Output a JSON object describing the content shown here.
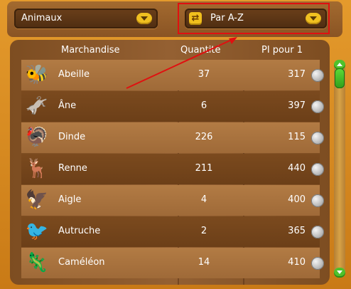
{
  "filters": {
    "category": "Animaux",
    "sort": "Par A-Z"
  },
  "table": {
    "columns": [
      "Marchandise",
      "Quantité",
      "PI pour 1"
    ],
    "rows": [
      {
        "name": "Abeille",
        "quantity": "37",
        "price": "317",
        "icon": "bee-icon"
      },
      {
        "name": "Âne",
        "quantity": "6",
        "price": "397",
        "icon": "donkey-icon"
      },
      {
        "name": "Dinde",
        "quantity": "226",
        "price": "115",
        "icon": "turkey-icon"
      },
      {
        "name": "Renne",
        "quantity": "211",
        "price": "440",
        "icon": "reindeer-icon"
      },
      {
        "name": "Aigle",
        "quantity": "4",
        "price": "400",
        "icon": "eagle-icon"
      },
      {
        "name": "Autruche",
        "quantity": "2",
        "price": "365",
        "icon": "ostrich-icon"
      },
      {
        "name": "Caméléon",
        "quantity": "14",
        "price": "410",
        "icon": "chameleon-icon"
      }
    ]
  },
  "colors": {
    "highlight": "#e01010",
    "scroll_accent": "#4fc12c",
    "dropdown_arrow": "#f0c020"
  }
}
